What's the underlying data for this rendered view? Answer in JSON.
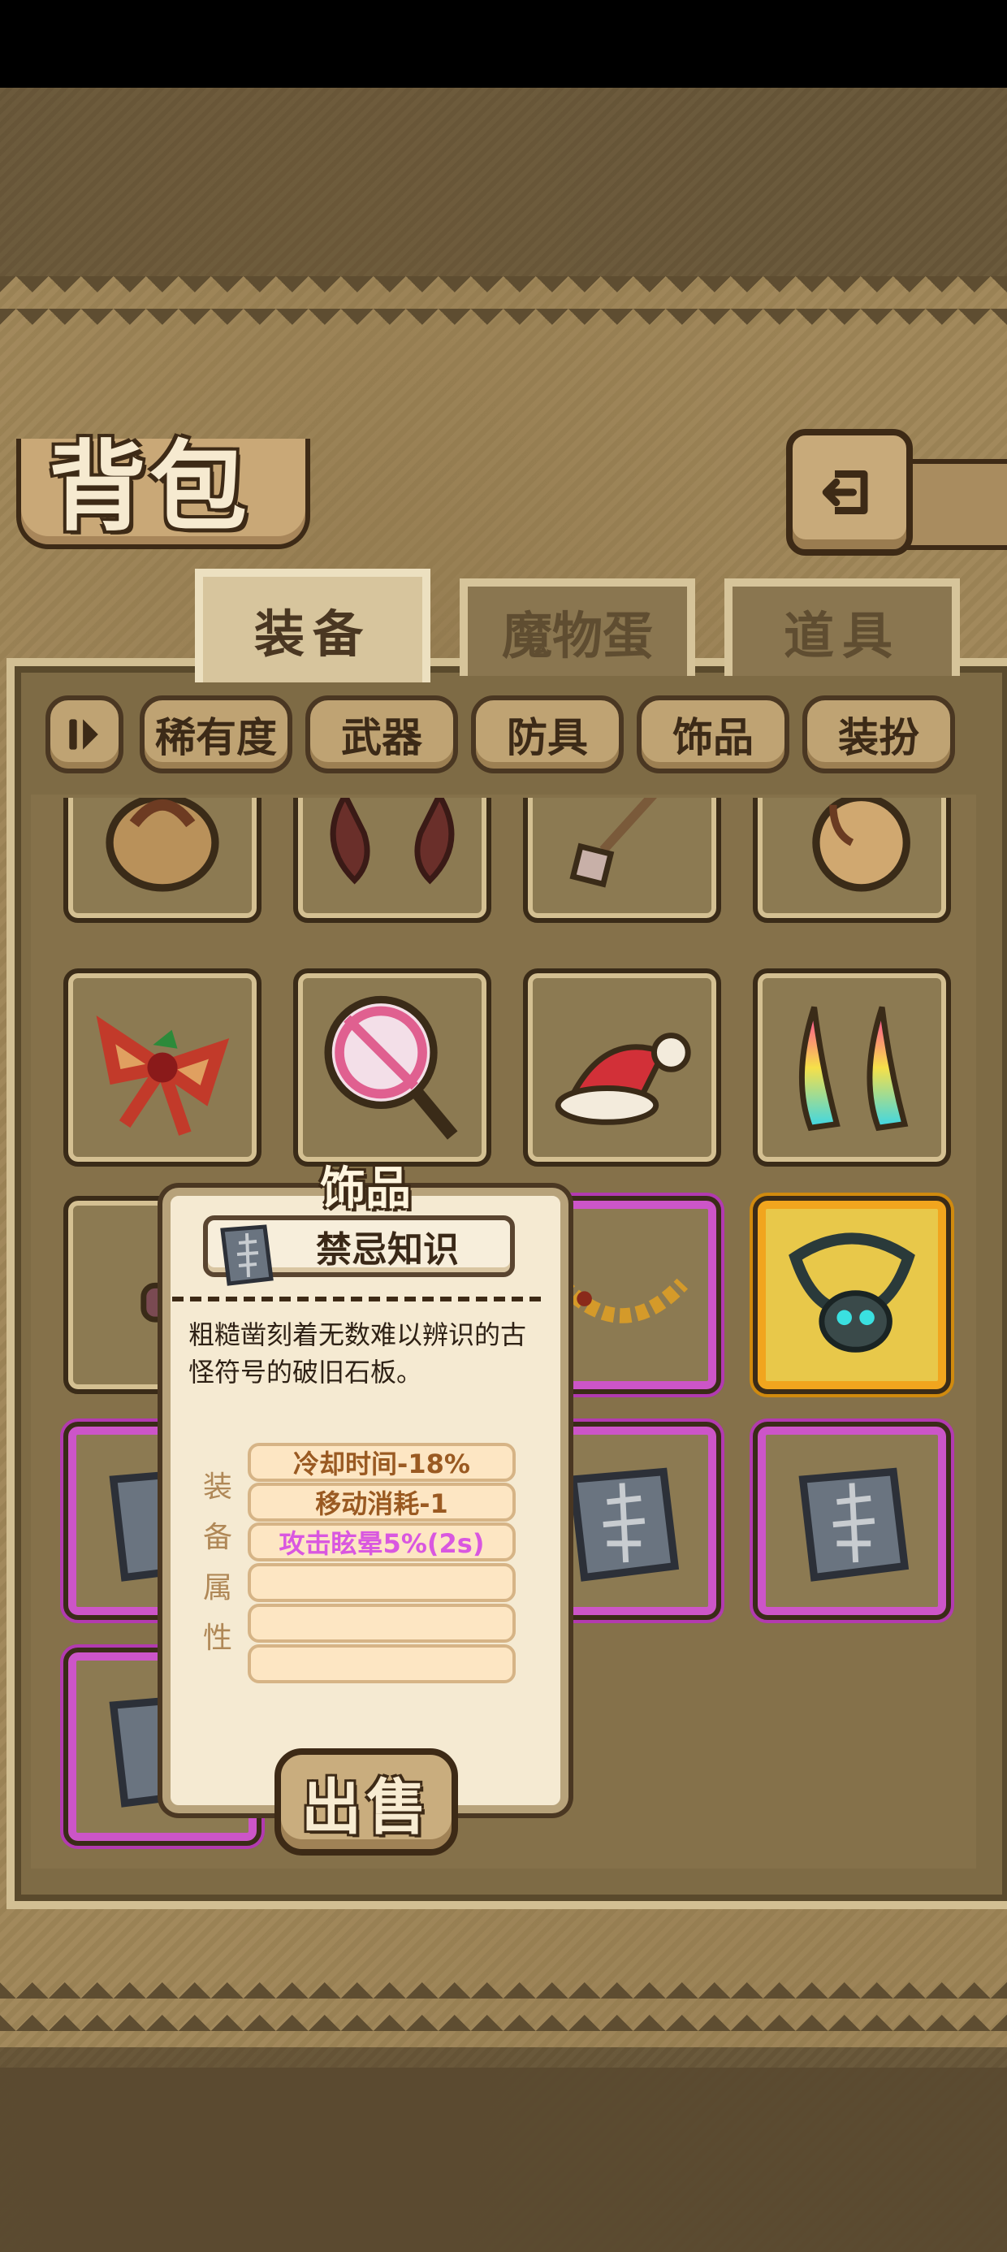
{
  "header": {
    "title": "背包"
  },
  "tabs": [
    {
      "label": "装备",
      "active": true
    },
    {
      "label": "魔物蛋",
      "active": false
    },
    {
      "label": "道具",
      "active": false
    }
  ],
  "filters": {
    "labels": [
      "稀有度",
      "武器",
      "防具",
      "饰品",
      "装扮"
    ]
  },
  "grid": {
    "items": [
      {
        "icon": "bag-icon",
        "rarity": "normal"
      },
      {
        "icon": "horns-brown-icon",
        "rarity": "normal"
      },
      {
        "icon": "shovel-icon",
        "rarity": "normal"
      },
      {
        "icon": "gourd-icon",
        "rarity": "normal"
      },
      {
        "icon": "bow-ribbon-icon",
        "rarity": "normal"
      },
      {
        "icon": "lollipop-icon",
        "rarity": "normal"
      },
      {
        "icon": "santa-hat-icon",
        "rarity": "normal"
      },
      {
        "icon": "rainbow-horns-icon",
        "rarity": "normal"
      },
      {
        "icon": "headband-icon",
        "rarity": "normal"
      },
      {
        "icon": "hidden-slot",
        "rarity": "normal"
      },
      {
        "icon": "gold-necklace-icon",
        "rarity": "purple"
      },
      {
        "icon": "skull-necklace-icon",
        "rarity": "gold"
      },
      {
        "icon": "stone-tablet-icon",
        "rarity": "purple"
      },
      {
        "icon": "hidden-slot",
        "rarity": "purple"
      },
      {
        "icon": "stone-tablet-icon",
        "rarity": "purple"
      },
      {
        "icon": "stone-tablet-icon",
        "rarity": "purple"
      },
      {
        "icon": "stone-tablet-icon",
        "rarity": "purple"
      }
    ]
  },
  "tooltip": {
    "category": "饰品",
    "name": "禁忌知识",
    "icon": "stone-tablet-icon",
    "description": "粗糙凿刻着无数难以辨识的古怪符号的破旧石板。",
    "stat_label": [
      "装",
      "备",
      "属",
      "性"
    ],
    "stats": [
      {
        "text": "冷却时间-18%",
        "color": "#9a5a22"
      },
      {
        "text": "移动消耗-1",
        "color": "#9a5a22"
      },
      {
        "text": "攻击眩晕5%(2s)",
        "color": "#d957e0"
      },
      {
        "text": "",
        "color": ""
      },
      {
        "text": "",
        "color": ""
      },
      {
        "text": "",
        "color": ""
      }
    ],
    "sell_label": "出售"
  }
}
